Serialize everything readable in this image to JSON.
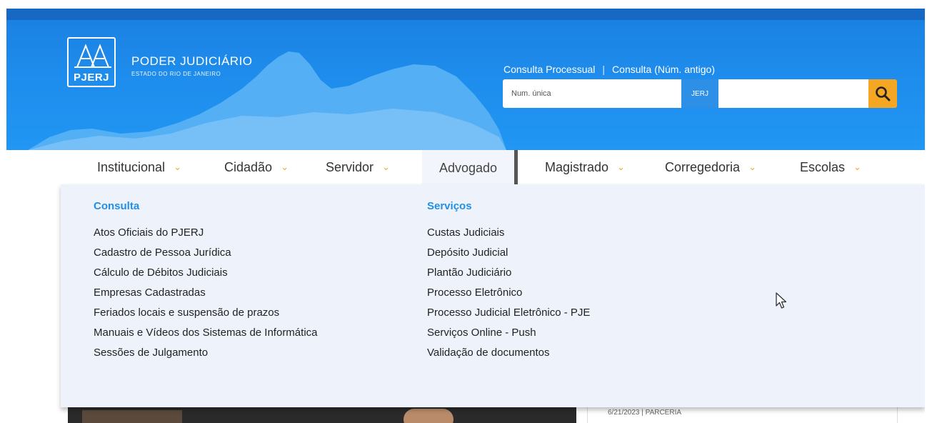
{
  "brand": {
    "logo_text": "PJERJ",
    "title": "PODER JUDICIÁRIO",
    "subtitle": "ESTADO DO RIO DE JANEIRO"
  },
  "header": {
    "consulta_processual": "Consulta Processual",
    "separator": "|",
    "consulta_antiga": "Consulta (Núm. antigo)",
    "search_placeholder": "Num. única",
    "search_mid": "JERJ",
    "search_icon": "search-icon"
  },
  "nav": {
    "items": [
      {
        "label": "Institucional",
        "has_chevron": true
      },
      {
        "label": "Cidadão",
        "has_chevron": true
      },
      {
        "label": "Servidor",
        "has_chevron": true
      },
      {
        "label": "Advogado",
        "has_chevron": false,
        "active": true
      },
      {
        "label": "Magistrado",
        "has_chevron": true
      },
      {
        "label": "Corregedoria",
        "has_chevron": true
      },
      {
        "label": "Escolas",
        "has_chevron": true
      }
    ],
    "chevron_glyph": "⌄"
  },
  "dropdown": {
    "consulta": {
      "heading": "Consulta",
      "items": [
        "Atos Oficiais do PJERJ",
        "Cadastro de Pessoa Jurídica",
        "Cálculo de Débitos Judiciais",
        "Empresas Cadastradas",
        "Feriados locais e suspensão de prazos",
        "Manuais e Vídeos dos Sistemas de Informática",
        "Sessões de Julgamento"
      ]
    },
    "servicos": {
      "heading": "Serviços",
      "items": [
        "Custas Judiciais",
        "Depósito Judicial",
        "Plantão Judiciário",
        "Processo Eletrônico",
        "Processo Judicial Eletrônico - PJE",
        "Serviços Online - Push",
        "Validação de documentos"
      ]
    }
  },
  "below": {
    "card_date": "6/21/2023 | PARCERIA"
  },
  "colors": {
    "header_blue": "#1e8cec",
    "accent_orange": "#f5a623",
    "dropdown_bg": "#eef3fb",
    "heading_blue": "#1f8fe8"
  }
}
